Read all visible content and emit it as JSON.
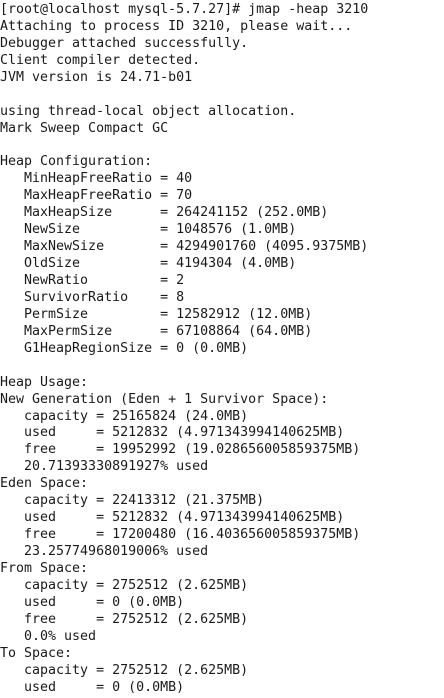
{
  "terminal": {
    "lines": [
      "[root@localhost mysql-5.7.27]# jmap -heap 3210",
      "Attaching to process ID 3210, please wait...",
      "Debugger attached successfully.",
      "Client compiler detected.",
      "JVM version is 24.71-b01",
      "",
      "using thread-local object allocation.",
      "Mark Sweep Compact GC",
      "",
      "Heap Configuration:",
      "   MinHeapFreeRatio = 40",
      "   MaxHeapFreeRatio = 70",
      "   MaxHeapSize      = 264241152 (252.0MB)",
      "   NewSize          = 1048576 (1.0MB)",
      "   MaxNewSize       = 4294901760 (4095.9375MB)",
      "   OldSize          = 4194304 (4.0MB)",
      "   NewRatio         = 2",
      "   SurvivorRatio    = 8",
      "   PermSize         = 12582912 (12.0MB)",
      "   MaxPermSize      = 67108864 (64.0MB)",
      "   G1HeapRegionSize = 0 (0.0MB)",
      "",
      "Heap Usage:",
      "New Generation (Eden + 1 Survivor Space):",
      "   capacity = 25165824 (24.0MB)",
      "   used     = 5212832 (4.971343994140625MB)",
      "   free     = 19952992 (19.028656005859375MB)",
      "   20.71393330891927% used",
      "Eden Space:",
      "   capacity = 22413312 (21.375MB)",
      "   used     = 5212832 (4.971343994140625MB)",
      "   free     = 17200480 (16.403656005859375MB)",
      "   23.25774968019006% used",
      "From Space:",
      "   capacity = 2752512 (2.625MB)",
      "   used     = 0 (0.0MB)",
      "   free     = 2752512 (2.625MB)",
      "   0.0% used",
      "To Space:",
      "   capacity = 2752512 (2.625MB)",
      "   used     = 0 (0.0MB)"
    ]
  }
}
